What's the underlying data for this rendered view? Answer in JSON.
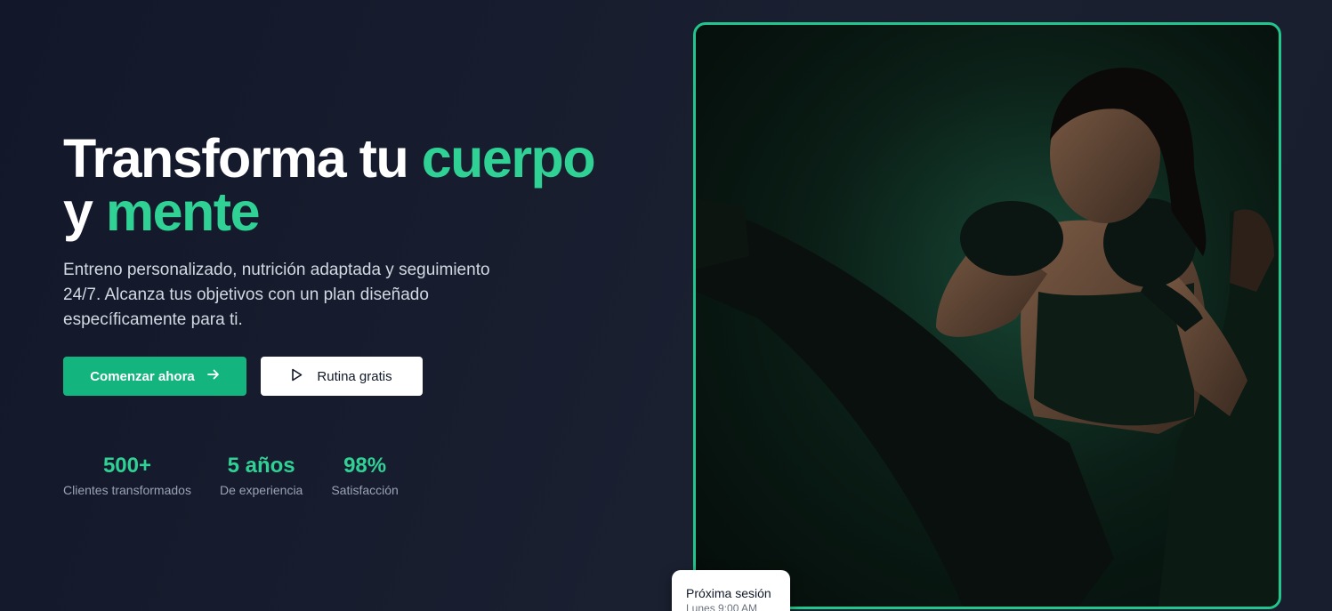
{
  "hero": {
    "title_part1": "Transforma tu ",
    "title_accent1": "cuerpo",
    "title_part2": "y ",
    "title_accent2": "mente",
    "subtitle": "Entreno personalizado, nutrición adaptada y seguimiento 24/7. Alcanza tus objetivos con un plan diseñado específicamente para ti."
  },
  "buttons": {
    "primary_label": "Comenzar ahora",
    "primary_icon": "arrow-right-icon",
    "secondary_label": "Rutina gratis",
    "secondary_icon": "play-icon"
  },
  "stats": [
    {
      "value": "500+",
      "label": "Clientes transformados"
    },
    {
      "value": "5 años",
      "label": "De experiencia"
    },
    {
      "value": "98%",
      "label": "Satisfacción"
    }
  ],
  "session_card": {
    "title": "Próxima sesión",
    "time": "Lunes 9:00 AM"
  },
  "colors": {
    "accent": "#2fd195",
    "primary_button": "#14b47f",
    "frame_border": "#22c58b",
    "background": "#161b2b"
  }
}
